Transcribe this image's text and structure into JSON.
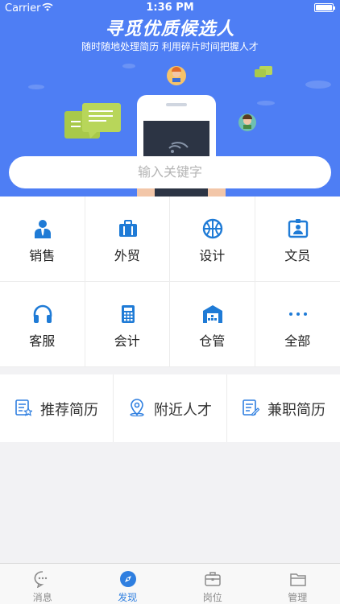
{
  "status_bar": {
    "carrier": "Carrier",
    "time": "1:36 PM"
  },
  "hero": {
    "title": "寻觅优质候选人",
    "subtitle": "随时随地处理简历 利用碎片时间把握人才"
  },
  "search": {
    "placeholder": "输入关键字"
  },
  "categories": [
    {
      "label": "销售",
      "icon": "salesperson-icon"
    },
    {
      "label": "外贸",
      "icon": "briefcase-icon"
    },
    {
      "label": "设计",
      "icon": "basketball-icon"
    },
    {
      "label": "文员",
      "icon": "id-card-icon"
    },
    {
      "label": "客服",
      "icon": "headset-icon"
    },
    {
      "label": "会计",
      "icon": "calculator-icon"
    },
    {
      "label": "仓管",
      "icon": "warehouse-icon"
    },
    {
      "label": "全部",
      "icon": "more-icon"
    }
  ],
  "shortcuts": [
    {
      "label": "推荐简历",
      "icon": "recommend-resume-icon"
    },
    {
      "label": "附近人才",
      "icon": "location-icon"
    },
    {
      "label": "兼职简历",
      "icon": "parttime-resume-icon"
    }
  ],
  "tabbar": [
    {
      "label": "消息",
      "icon": "chat-icon",
      "active": false
    },
    {
      "label": "发现",
      "icon": "compass-icon",
      "active": true
    },
    {
      "label": "岗位",
      "icon": "job-briefcase-icon",
      "active": false
    },
    {
      "label": "管理",
      "icon": "folder-icon",
      "active": false
    }
  ],
  "colors": {
    "primary": "#2f7fe0",
    "hero_bg": "#4e7ef4",
    "icon_blue": "#1f7bd6"
  }
}
